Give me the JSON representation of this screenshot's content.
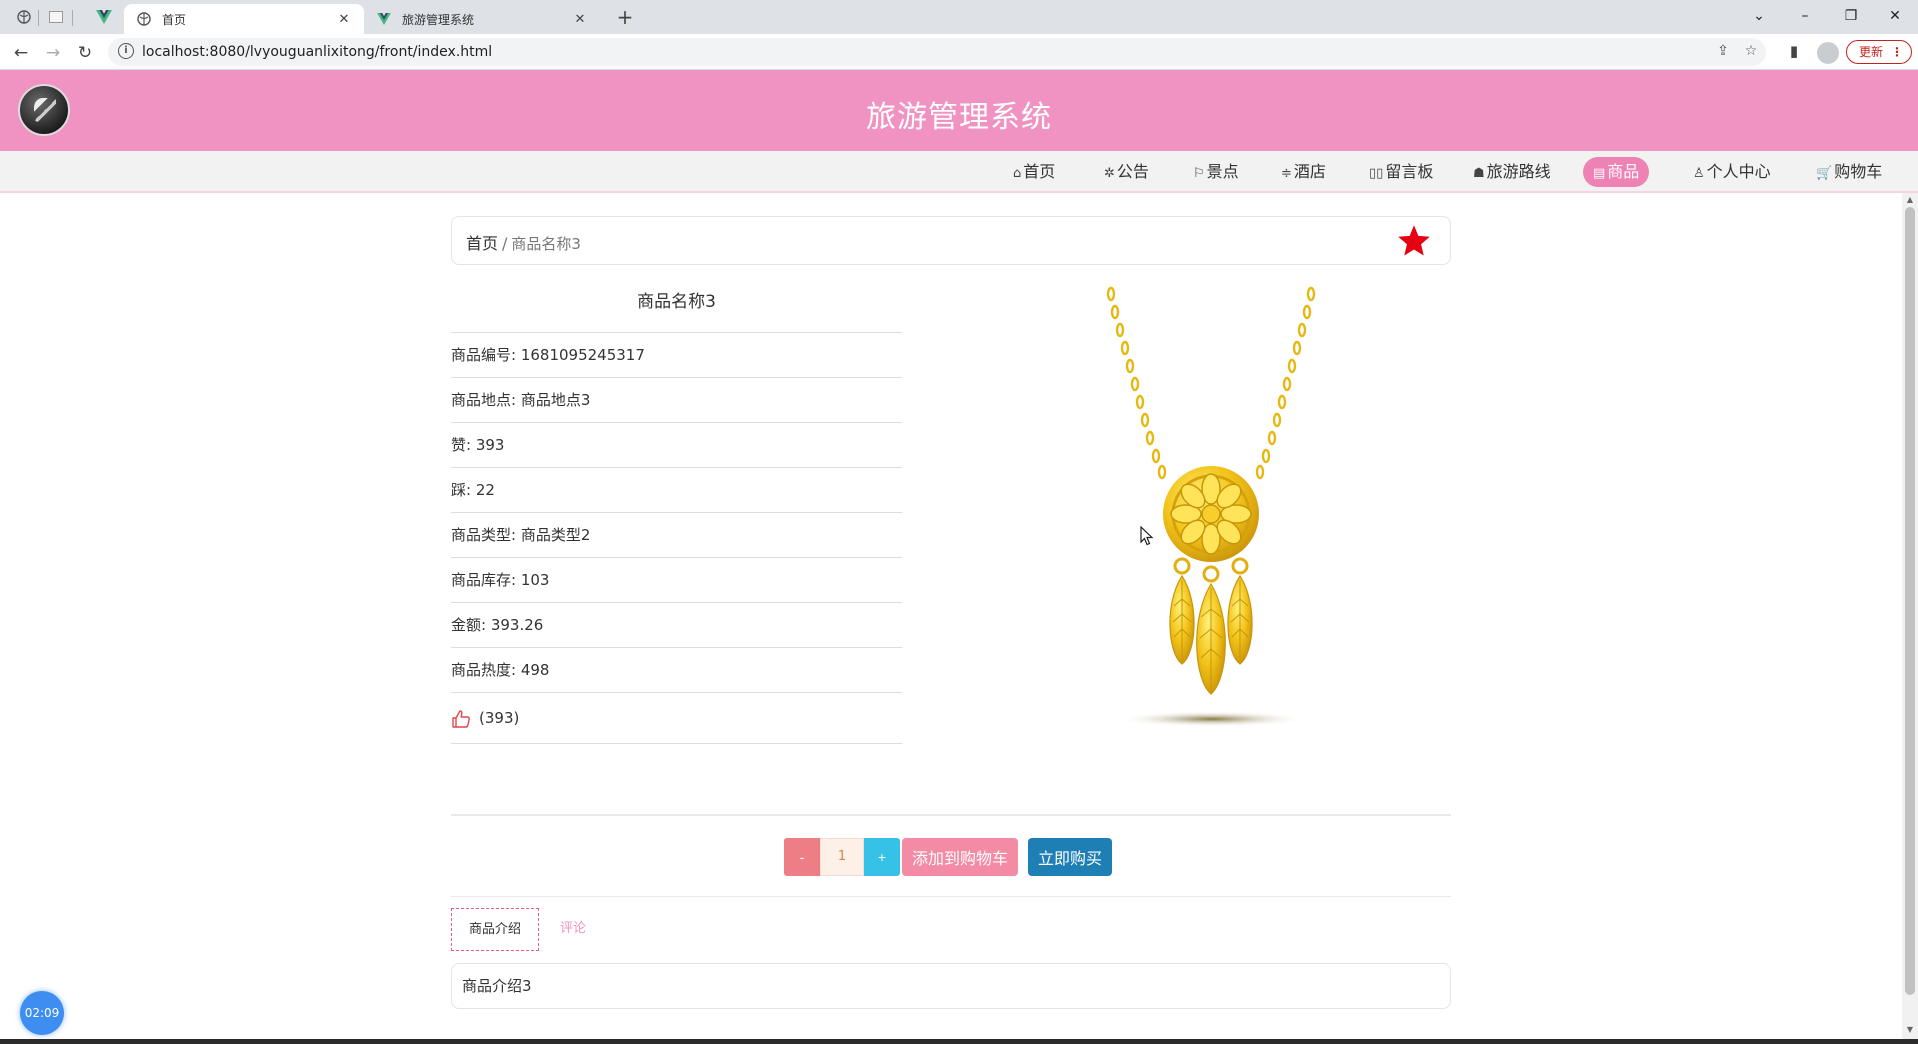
{
  "browser": {
    "tabs": [
      {
        "title": "首页",
        "active": true
      },
      {
        "title": "旅游管理系统",
        "active": false
      }
    ],
    "url": "localhost:8080/lvyouguanlixitong/front/index.html",
    "update_label": "更新",
    "update_menu": "⋮",
    "tab_close": "✕",
    "new_tab": "+"
  },
  "site": {
    "title": "旅游管理系统"
  },
  "nav": {
    "items": [
      {
        "icon": "⌂",
        "label": "首页"
      },
      {
        "icon": "✲",
        "label": "公告"
      },
      {
        "icon": "⚐",
        "label": "景点"
      },
      {
        "icon": "≑",
        "label": "酒店"
      },
      {
        "icon": "▯▯",
        "label": "留言板"
      },
      {
        "icon": "☗",
        "label": "旅游路线"
      },
      {
        "icon": "▤",
        "label": "商品"
      },
      {
        "icon": "♙",
        "label": "个人中心"
      },
      {
        "icon": "🛒",
        "label": "购物车"
      }
    ],
    "active_index": 6
  },
  "breadcrumb": {
    "home": "首页",
    "separator": "/",
    "current": "商品名称3"
  },
  "product": {
    "name": "商品名称3",
    "rows": [
      "商品编号: 1681095245317",
      "商品地点: 商品地点3",
      "赞: 393",
      "踩: 22",
      "商品类型: 商品类型2",
      "商品库存: 103",
      "金额: 393.26",
      "商品热度: 498"
    ],
    "likes_display": "(393)"
  },
  "cart": {
    "minus": "-",
    "quantity": "1",
    "plus": "+",
    "add_label": "添加到购物车",
    "buy_label": "立即购买"
  },
  "tabs": {
    "intro": "商品介绍",
    "comments": "评论"
  },
  "intro_text": "商品介绍3",
  "clock": "02:09",
  "colors": {
    "header_pink": "#f093c3",
    "active_nav": "#ee82b5",
    "buy_blue": "#1e7fb5",
    "cart_pink": "#f28ba3",
    "star_red": "#e60012"
  }
}
